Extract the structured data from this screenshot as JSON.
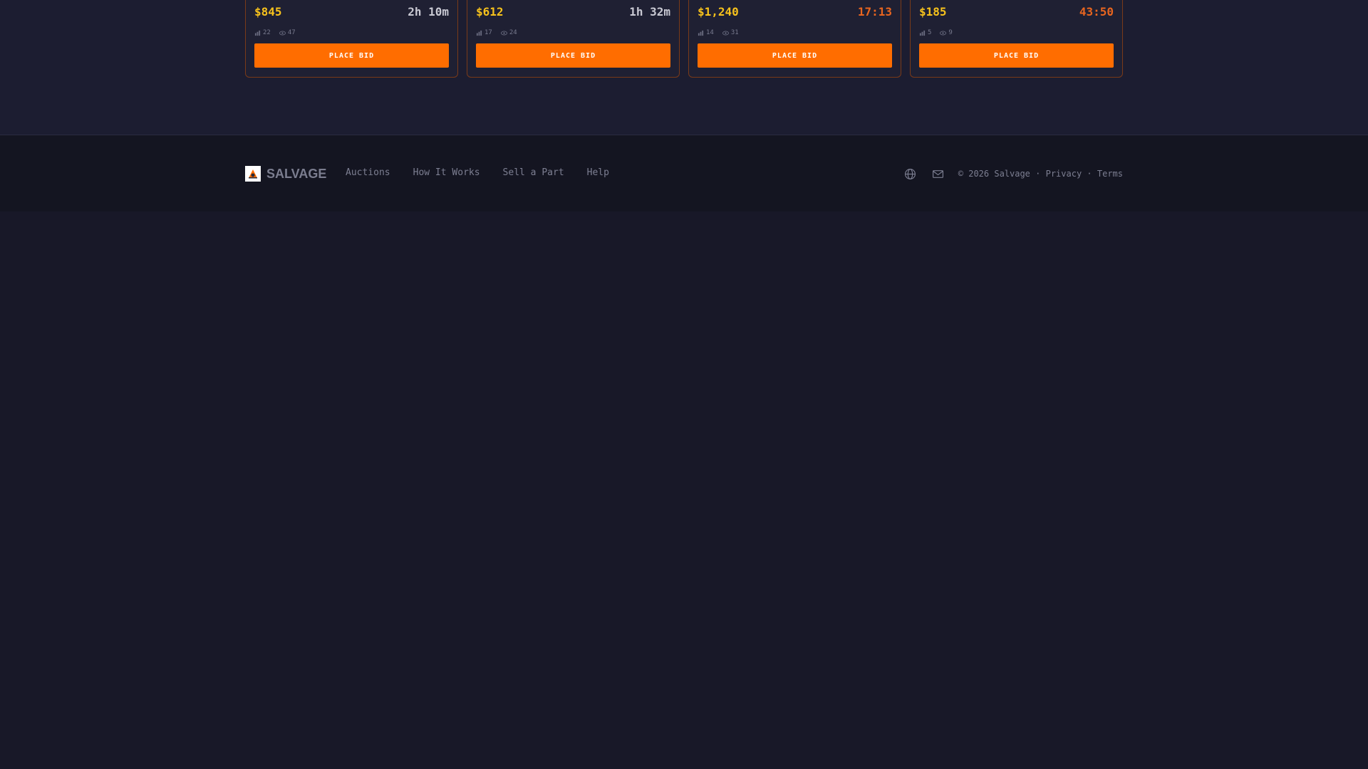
{
  "auctions": [
    {
      "price": "$845",
      "timer": "2h 10m",
      "timer_state": "normal",
      "bids": "22",
      "watchers": "47",
      "button": "PLACE BID"
    },
    {
      "price": "$612",
      "timer": "1h 32m",
      "timer_state": "normal",
      "bids": "17",
      "watchers": "24",
      "button": "PLACE BID"
    },
    {
      "price": "$1,240",
      "timer": "17:13",
      "timer_state": "urgent",
      "bids": "14",
      "watchers": "31",
      "button": "PLACE BID"
    },
    {
      "price": "$185",
      "timer": "43:50",
      "timer_state": "urgent",
      "bids": "5",
      "watchers": "9",
      "button": "PLACE BID"
    }
  ],
  "footer": {
    "brand": "SALVAGE",
    "nav": [
      "Auctions",
      "How It Works",
      "Sell a Part",
      "Help"
    ],
    "copyright": "© 2026 Salvage",
    "sep1": " · ",
    "privacy": "Privacy",
    "sep2": " · ",
    "terms": "Terms",
    "icons": [
      "globe-icon",
      "mail-icon"
    ]
  },
  "colors": {
    "accent": "#ff6d00",
    "price": "#f7c21c",
    "urgent": "#e8651f",
    "background": "#181828"
  }
}
